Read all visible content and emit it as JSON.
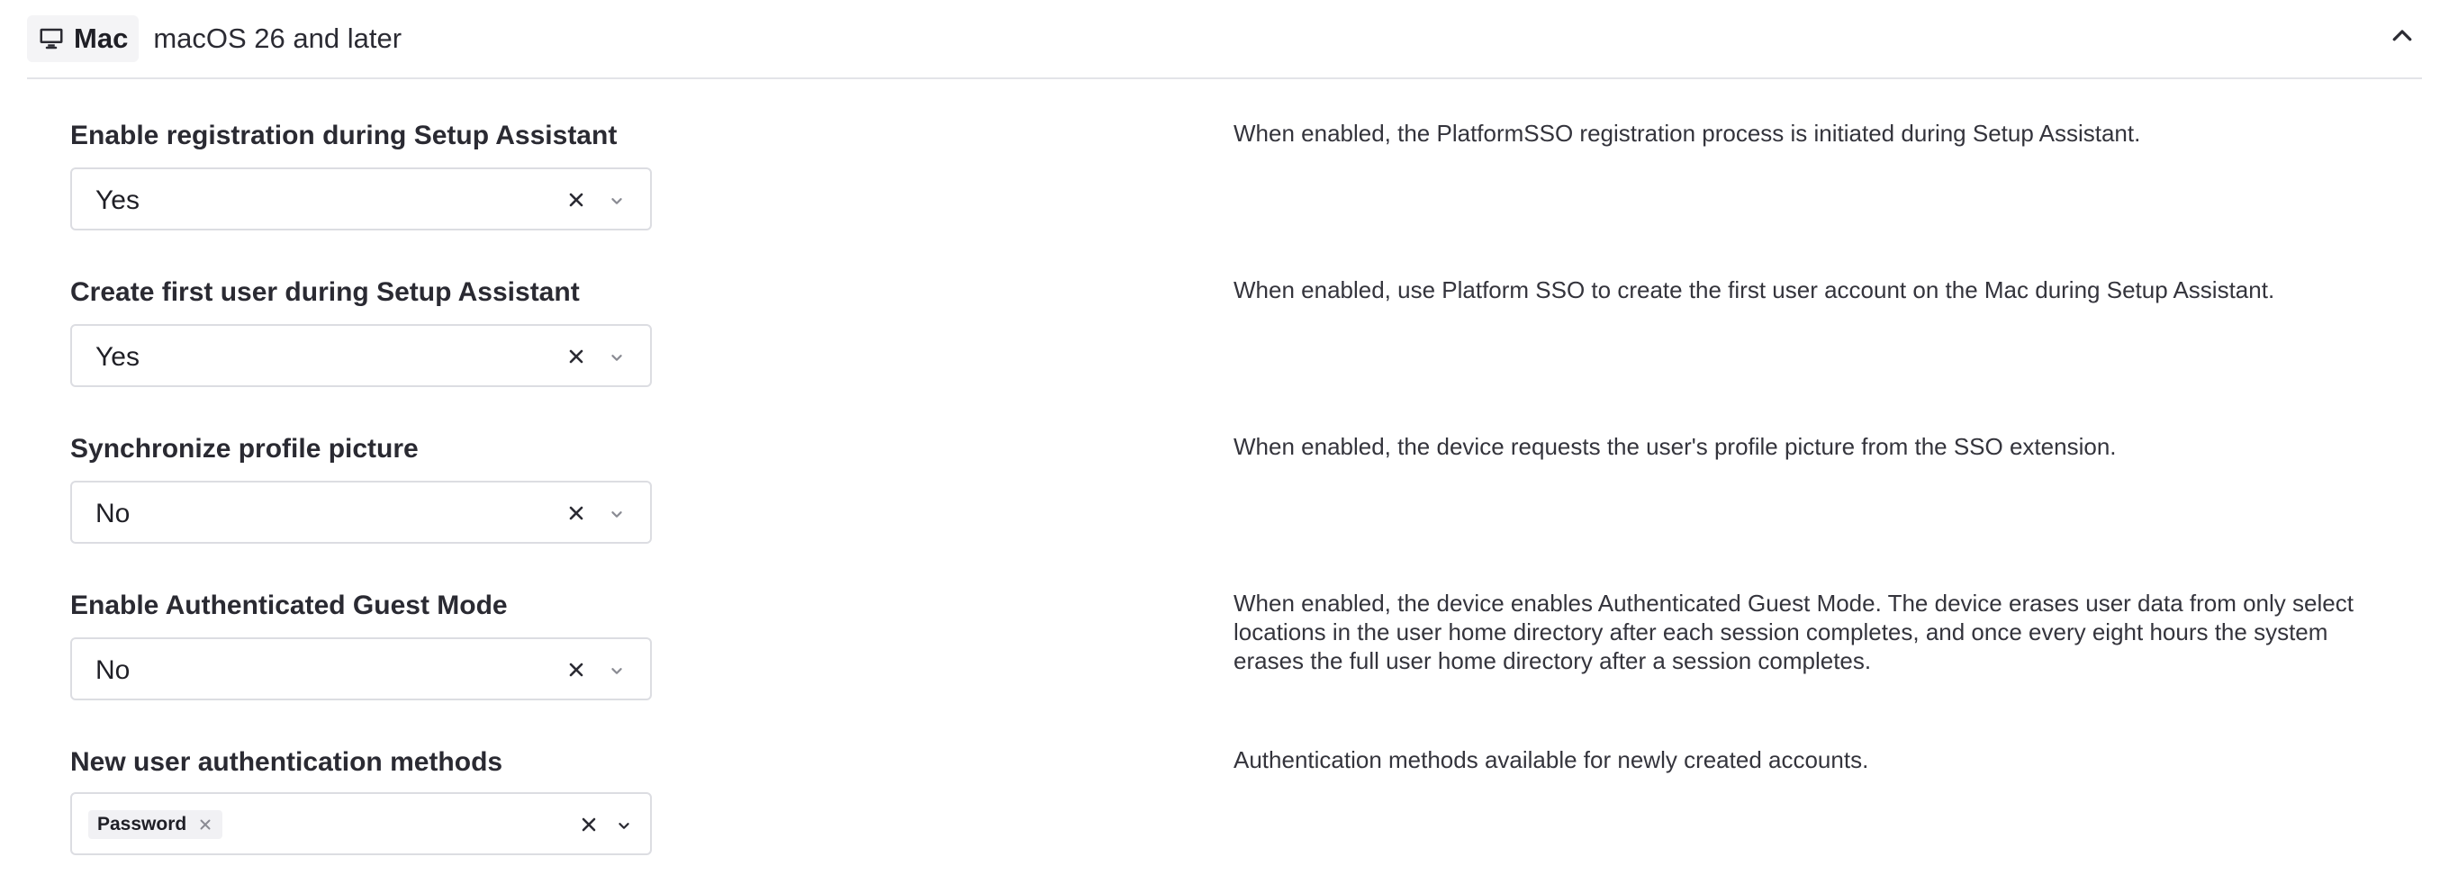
{
  "header": {
    "platform_icon": "desktop-monitor-icon",
    "platform_name": "Mac",
    "os_version": "macOS 26 and later",
    "collapse_icon": "chevron-up-icon"
  },
  "settings": [
    {
      "label": "Enable registration during Setup Assistant",
      "value": "Yes",
      "description": "When enabled, the PlatformSSO registration process is initiated during Setup Assistant."
    },
    {
      "label": "Create first user during Setup Assistant",
      "value": "Yes",
      "description": "When enabled, use Platform SSO to create the first user account on the Mac during Setup Assistant."
    },
    {
      "label": "Synchronize profile picture",
      "value": "No",
      "description": "When enabled, the device requests the user's profile picture from the SSO extension."
    },
    {
      "label": "Enable Authenticated Guest Mode",
      "value": "No",
      "description": "When enabled, the device enables Authenticated Guest Mode. The device erases user data from only select locations in the user home directory after each session completes, and once every eight hours the system erases the full user home directory after a session completes."
    },
    {
      "label": "New user authentication methods",
      "selected_tags": [
        "Password"
      ],
      "description": "Authentication methods available for newly created accounts."
    }
  ],
  "icons": {
    "clear": "clear-x-icon",
    "dropdown": "chevron-down-icon",
    "tag_remove": "tag-remove-x-icon"
  },
  "colors": {
    "border": "#dcdde2",
    "divider": "#e3e4e8",
    "text": "#2b2b33",
    "chip_bg": "#f4f4f6"
  }
}
